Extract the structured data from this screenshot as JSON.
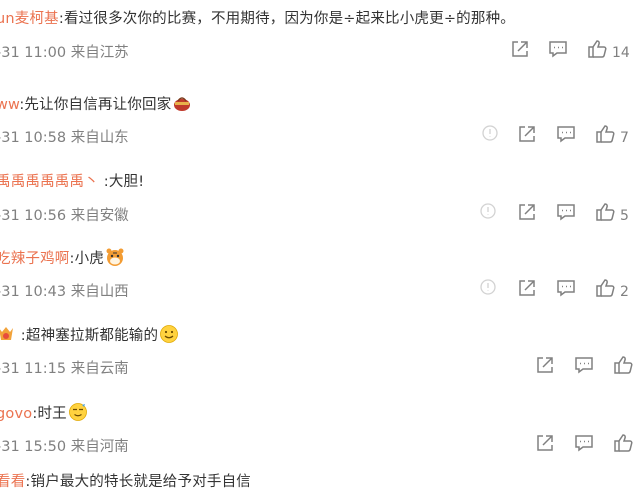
{
  "comments": [
    {
      "user": "un麦柯基",
      "text": "看过很多次你的比赛，不用期待，因为你是÷起来比小虎更÷的那种。",
      "meta": "-31 11:00 来自江苏",
      "likes": "14",
      "has_report": false,
      "emoji": ""
    },
    {
      "user": "ww",
      "text": "先让你自信再让你回家",
      "meta": "-31 10:58 来自山东",
      "likes": "7",
      "has_report": true,
      "emoji": "basket-emoji"
    },
    {
      "user": "禹禹禹禹禹禹丶",
      "text": "大胆!",
      "meta": "-31 10:56 来自安徽",
      "likes": "5",
      "has_report": true,
      "emoji": ""
    },
    {
      "user": "吃辣子鸡啊",
      "text": "小虎",
      "meta": "-31 10:43 来自山西",
      "likes": "2",
      "has_report": true,
      "emoji": "tiger-emoji"
    },
    {
      "user": "",
      "text": "超神塞拉斯都能输的",
      "meta": "-31 11:15 来自云南",
      "likes": "",
      "has_report": false,
      "emoji": "smile-emoji",
      "avatar_badge": true
    },
    {
      "user": "ovo",
      "text": "时王",
      "meta": "-31 15:50 来自河南",
      "likes": "",
      "has_report": false,
      "emoji": "proud-emoji",
      "user_prefix_icon": "sun-icon"
    },
    {
      "user": "看看",
      "text": "销户最大的特长就是给予对手自信",
      "meta": "",
      "likes": "",
      "has_report": false,
      "emoji": ""
    }
  ],
  "colors": {
    "username": "#eb7350",
    "text": "#333333",
    "meta": "#808080",
    "icon": "#808080"
  },
  "icons": {
    "share": "share-icon",
    "comment": "comment-icon",
    "like": "thumb-up-icon",
    "report": "report-icon"
  }
}
